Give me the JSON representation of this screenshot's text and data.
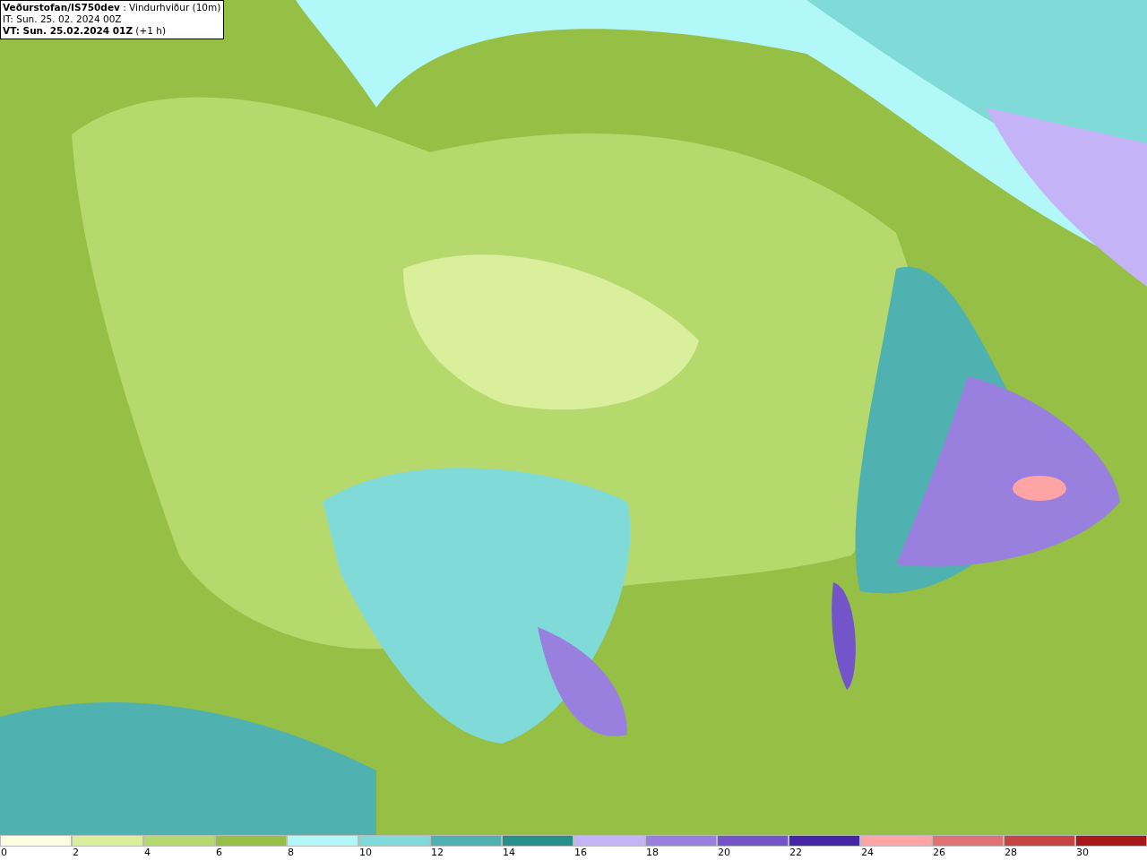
{
  "title_box": {
    "lines": [
      "**Veðurstofan/IS750dev** : Vindurhviður (10m)",
      "IT: Sun. 25. 02. 2024 00Z",
      "**VT: Sun. 25.02.2024 01Z** (+1 h)"
    ]
  },
  "legend": [
    {
      "label": "0",
      "color": "#fafde0"
    },
    {
      "label": "2",
      "color": "#d9ef9c"
    },
    {
      "label": "4",
      "color": "#b6d96e"
    },
    {
      "label": "6",
      "color": "#95bf45"
    },
    {
      "label": "8",
      "color": "#b2f8f8"
    },
    {
      "label": "10",
      "color": "#80dad8"
    },
    {
      "label": "12",
      "color": "#50b2b0"
    },
    {
      "label": "14",
      "color": "#278e8a"
    },
    {
      "label": "16",
      "color": "#c5b3f7"
    },
    {
      "label": "18",
      "color": "#9a80de"
    },
    {
      "label": "20",
      "color": "#7455c9"
    },
    {
      "label": "22",
      "color": "#4527a5"
    },
    {
      "label": "24",
      "color": "#ffa4a4"
    },
    {
      "label": "26",
      "color": "#e07474"
    },
    {
      "label": "28",
      "color": "#c64444"
    },
    {
      "label": "30",
      "color": "#a81818"
    }
  ]
}
